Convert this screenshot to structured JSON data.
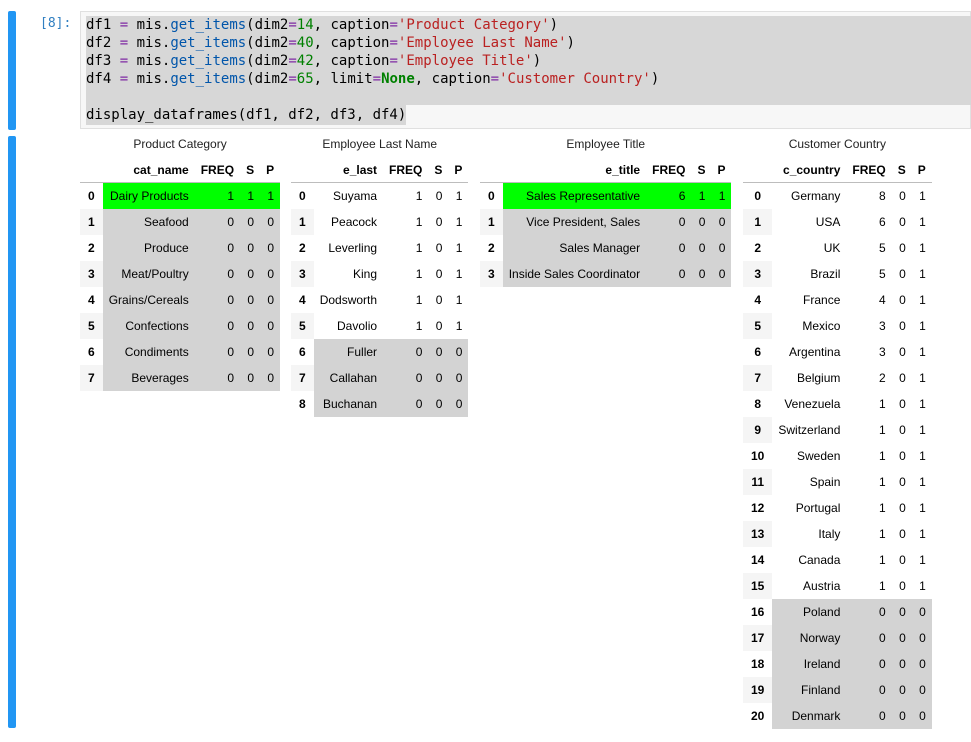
{
  "cell": {
    "prompt": "[8]:",
    "code": [
      [
        [
          "df1 ",
          ""
        ],
        [
          "=",
          "kw"
        ],
        [
          " mis.",
          ""
        ],
        [
          "get_items",
          "fn"
        ],
        [
          "(dim2",
          ""
        ],
        [
          "=",
          "kw"
        ],
        [
          "14",
          "num"
        ],
        [
          ", caption",
          ""
        ],
        [
          "=",
          "kw"
        ],
        [
          "'Product Category'",
          "str"
        ],
        [
          ")",
          ""
        ]
      ],
      [
        [
          "df2 ",
          ""
        ],
        [
          "=",
          "kw"
        ],
        [
          " mis.",
          ""
        ],
        [
          "get_items",
          "fn"
        ],
        [
          "(dim2",
          ""
        ],
        [
          "=",
          "kw"
        ],
        [
          "40",
          "num"
        ],
        [
          ", caption",
          ""
        ],
        [
          "=",
          "kw"
        ],
        [
          "'Employee Last Name'",
          "str"
        ],
        [
          ")",
          ""
        ]
      ],
      [
        [
          "df3 ",
          ""
        ],
        [
          "=",
          "kw"
        ],
        [
          " mis.",
          ""
        ],
        [
          "get_items",
          "fn"
        ],
        [
          "(dim2",
          ""
        ],
        [
          "=",
          "kw"
        ],
        [
          "42",
          "num"
        ],
        [
          ", caption",
          ""
        ],
        [
          "=",
          "kw"
        ],
        [
          "'Employee Title'",
          "str"
        ],
        [
          ")",
          ""
        ]
      ],
      [
        [
          "df4 ",
          ""
        ],
        [
          "=",
          "kw"
        ],
        [
          " mis.",
          ""
        ],
        [
          "get_items",
          "fn"
        ],
        [
          "(dim2",
          ""
        ],
        [
          "=",
          "kw"
        ],
        [
          "65",
          "num"
        ],
        [
          ", limit",
          ""
        ],
        [
          "=",
          "kw"
        ],
        [
          "None",
          "bold"
        ],
        [
          ", caption",
          ""
        ],
        [
          "=",
          "kw"
        ],
        [
          "'Customer Country'",
          "str"
        ],
        [
          ")",
          ""
        ]
      ],
      [],
      [
        [
          "display_dataframes(df1, df2, df3, df4)",
          ""
        ]
      ]
    ]
  },
  "colors": {
    "accent": "#2196f3",
    "highlight_max": "#00ff00",
    "highlight_zero": "#d3d3d3"
  },
  "tables": [
    {
      "caption": "Product Category",
      "columns": [
        "cat_name",
        "FREQ",
        "S",
        "P"
      ],
      "rows": [
        [
          "Dairy Products",
          1,
          1,
          1
        ],
        [
          "Seafood",
          0,
          0,
          0
        ],
        [
          "Produce",
          0,
          0,
          0
        ],
        [
          "Meat/Poultry",
          0,
          0,
          0
        ],
        [
          "Grains/Cereals",
          0,
          0,
          0
        ],
        [
          "Confections",
          0,
          0,
          0
        ],
        [
          "Condiments",
          0,
          0,
          0
        ],
        [
          "Beverages",
          0,
          0,
          0
        ]
      ]
    },
    {
      "caption": "Employee Last Name",
      "columns": [
        "e_last",
        "FREQ",
        "S",
        "P"
      ],
      "rows": [
        [
          "Suyama",
          1,
          0,
          1
        ],
        [
          "Peacock",
          1,
          0,
          1
        ],
        [
          "Leverling",
          1,
          0,
          1
        ],
        [
          "King",
          1,
          0,
          1
        ],
        [
          "Dodsworth",
          1,
          0,
          1
        ],
        [
          "Davolio",
          1,
          0,
          1
        ],
        [
          "Fuller",
          0,
          0,
          0
        ],
        [
          "Callahan",
          0,
          0,
          0
        ],
        [
          "Buchanan",
          0,
          0,
          0
        ]
      ]
    },
    {
      "caption": "Employee Title",
      "columns": [
        "e_title",
        "FREQ",
        "S",
        "P"
      ],
      "rows": [
        [
          "Sales Representative",
          6,
          1,
          1
        ],
        [
          "Vice President, Sales",
          0,
          0,
          0
        ],
        [
          "Sales Manager",
          0,
          0,
          0
        ],
        [
          "Inside Sales Coordinator",
          0,
          0,
          0
        ]
      ]
    },
    {
      "caption": "Customer Country",
      "columns": [
        "c_country",
        "FREQ",
        "S",
        "P"
      ],
      "rows": [
        [
          "Germany",
          8,
          0,
          1
        ],
        [
          "USA",
          6,
          0,
          1
        ],
        [
          "UK",
          5,
          0,
          1
        ],
        [
          "Brazil",
          5,
          0,
          1
        ],
        [
          "France",
          4,
          0,
          1
        ],
        [
          "Mexico",
          3,
          0,
          1
        ],
        [
          "Argentina",
          3,
          0,
          1
        ],
        [
          "Belgium",
          2,
          0,
          1
        ],
        [
          "Venezuela",
          1,
          0,
          1
        ],
        [
          "Switzerland",
          1,
          0,
          1
        ],
        [
          "Sweden",
          1,
          0,
          1
        ],
        [
          "Spain",
          1,
          0,
          1
        ],
        [
          "Portugal",
          1,
          0,
          1
        ],
        [
          "Italy",
          1,
          0,
          1
        ],
        [
          "Canada",
          1,
          0,
          1
        ],
        [
          "Austria",
          1,
          0,
          1
        ],
        [
          "Poland",
          0,
          0,
          0
        ],
        [
          "Norway",
          0,
          0,
          0
        ],
        [
          "Ireland",
          0,
          0,
          0
        ],
        [
          "Finland",
          0,
          0,
          0
        ],
        [
          "Denmark",
          0,
          0,
          0
        ]
      ]
    }
  ]
}
